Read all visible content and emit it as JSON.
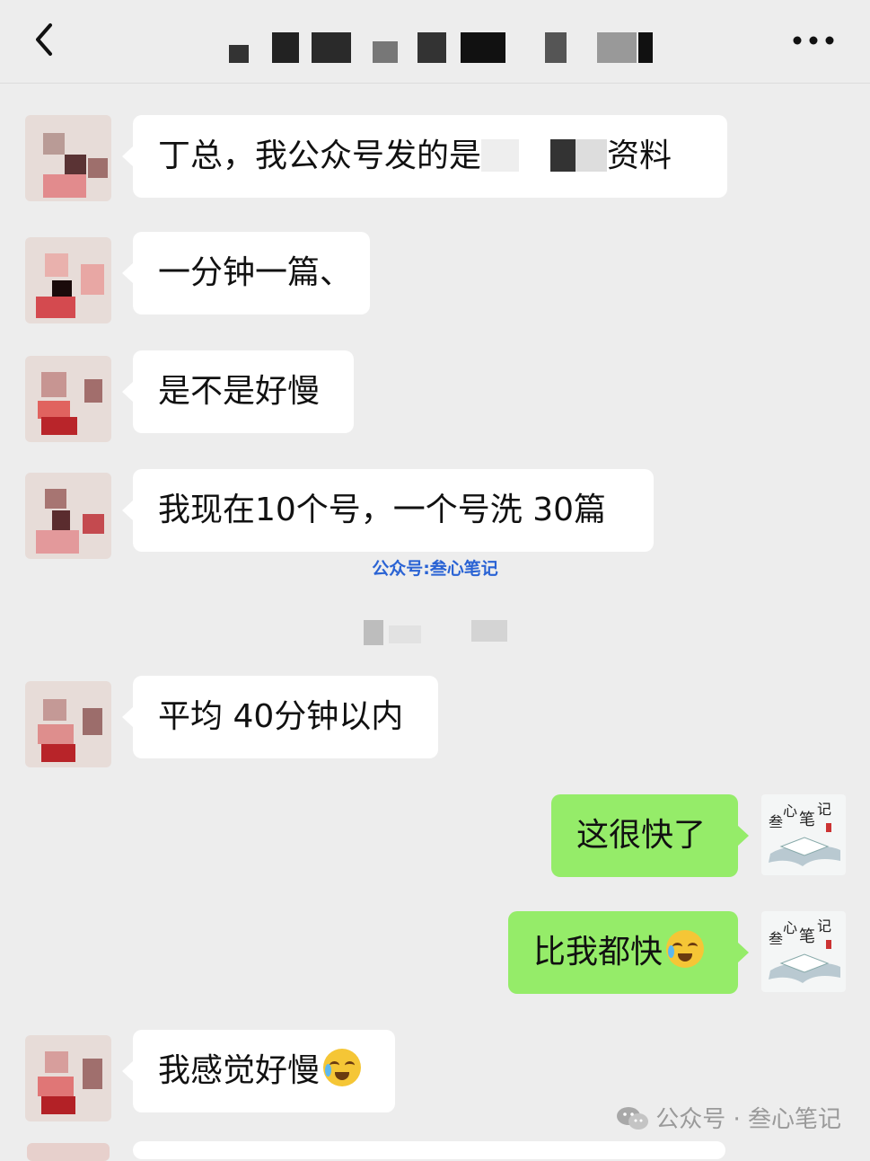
{
  "header": {
    "back_icon": "back-arrow-icon",
    "title_redacted": true,
    "more_icon": "more-dots-icon"
  },
  "messages": [
    {
      "side": "left",
      "text": "丁总，我公众号发的是",
      "text_suffix": "资料",
      "partly_redacted": true
    },
    {
      "side": "left",
      "text": "一分钟一篇、"
    },
    {
      "side": "left",
      "text": "是不是好慢"
    },
    {
      "side": "left",
      "text": "我现在10个号，一个号洗 30篇"
    },
    {
      "side": "left",
      "text": "平均 40分钟以内"
    },
    {
      "side": "right",
      "text": "这很快了"
    },
    {
      "side": "right",
      "text": "比我都快",
      "emoji": "crying-laughing-emoji"
    },
    {
      "side": "left",
      "text": "我感觉好慢",
      "emoji": "crying-laughing-emoji"
    }
  ],
  "watermark_middle": "公众号:叁心笔记",
  "watermark_footer": "公众号 · 叁心笔记",
  "self_avatar_text": [
    "心",
    "笔",
    "记",
    "叁"
  ],
  "colors": {
    "background": "#ededed",
    "self_bubble": "#95ec69",
    "other_bubble": "#ffffff",
    "watermark_blue": "#2a63d4"
  }
}
